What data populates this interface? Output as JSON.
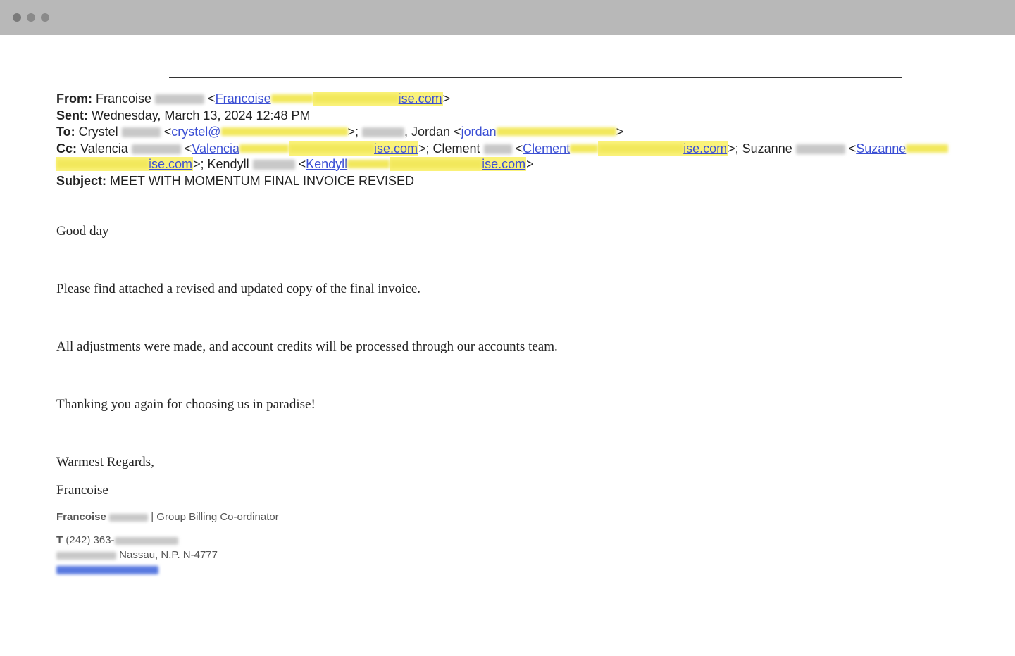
{
  "header": {
    "fromLabel": "From:",
    "fromName": "Francoise",
    "fromEmailPrefix": "Francoise",
    "fromEmailSuffix": "ise.com",
    "sentLabel": "Sent:",
    "sentValue": "Wednesday, March 13, 2024 12:48 PM",
    "toLabel": "To:",
    "toName1": "Crystel",
    "toEmail1Prefix": "crystel@",
    "toName2": "Jordan",
    "toEmail2Prefix": "jordan",
    "ccLabel": "Cc:",
    "ccName1": "Valencia",
    "ccEmail1Prefix": "Valencia",
    "ccEmail1Suffix": "ise.com",
    "ccName2": "Clement",
    "ccEmail2Prefix": "Clement",
    "ccEmail2Suffix": "ise.com",
    "ccName3": "Suzanne",
    "ccEmail3Prefix": "Suzanne",
    "ccEmail3Suffix": "ise.com",
    "ccName4": "Kendyll",
    "ccEmail4Prefix": "Kendyll",
    "ccEmail4Suffix": "ise.com",
    "subjectLabel": "Subject:",
    "subjectValue": "MEET WITH MOMENTUM FINAL INVOICE REVISED"
  },
  "body": {
    "greeting": "Good day",
    "para1": "Please find attached a revised and updated copy of the final invoice.",
    "para2": "All adjustments were made, and account credits will be processed through our accounts team.",
    "para3": "Thanking you again for choosing us in paradise!",
    "closing": "Warmest Regards,",
    "senderName": "Francoise"
  },
  "signature": {
    "name": "Francoise",
    "title": "Group Billing Co-ordinator",
    "phoneLabel": "T",
    "phonePrefix": "(242) 363-",
    "addressSuffix": "Nassau, N.P. N-4777"
  }
}
